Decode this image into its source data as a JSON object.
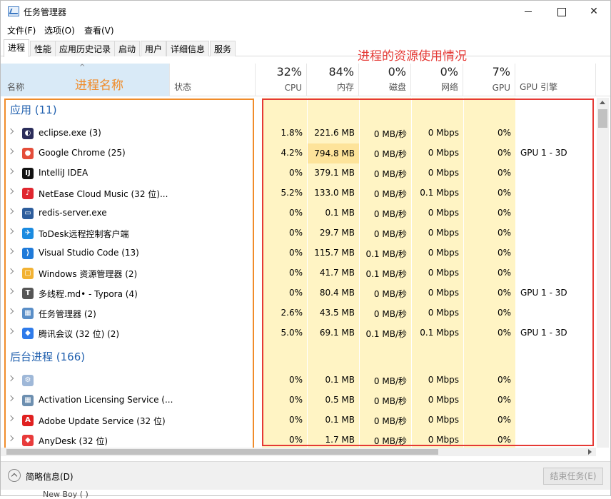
{
  "window": {
    "title": "任务管理器"
  },
  "menu": [
    "文件(F)",
    "选项(O)",
    "查看(V)"
  ],
  "tabs": [
    "进程",
    "性能",
    "应用历史记录",
    "启动",
    "用户",
    "详细信息",
    "服务"
  ],
  "header": {
    "name": "名称",
    "status": "状态",
    "cpu_pct": "32%",
    "cpu": "CPU",
    "mem_pct": "84%",
    "mem": "内存",
    "disk_pct": "0%",
    "disk": "磁盘",
    "net_pct": "0%",
    "net": "网络",
    "gpu_pct": "7%",
    "gpu": "GPU",
    "gpu_engine": "GPU 引擎"
  },
  "annotations": {
    "name_label": "进程名称",
    "resource_label": "进程的资源使用情况"
  },
  "groups": {
    "apps": "应用 (11)",
    "background": "后台进程 (166)"
  },
  "apps": [
    {
      "name": "eclipse.exe (3)",
      "cpu": "1.8%",
      "mem": "221.6 MB",
      "disk": "0 MB/秒",
      "net": "0 Mbps",
      "gpu": "0%",
      "gpu_engine": ""
    },
    {
      "name": "Google Chrome (25)",
      "cpu": "4.2%",
      "mem": "794.8 MB",
      "disk": "0 MB/秒",
      "net": "0 Mbps",
      "gpu": "0%",
      "gpu_engine": "GPU 1 - 3D"
    },
    {
      "name": "IntelliJ IDEA",
      "cpu": "0%",
      "mem": "379.1 MB",
      "disk": "0 MB/秒",
      "net": "0 Mbps",
      "gpu": "0%",
      "gpu_engine": ""
    },
    {
      "name": "NetEase Cloud Music (32 位)...",
      "cpu": "5.2%",
      "mem": "133.0 MB",
      "disk": "0 MB/秒",
      "net": "0.1 Mbps",
      "gpu": "0%",
      "gpu_engine": ""
    },
    {
      "name": "redis-server.exe",
      "cpu": "0%",
      "mem": "0.1 MB",
      "disk": "0 MB/秒",
      "net": "0 Mbps",
      "gpu": "0%",
      "gpu_engine": ""
    },
    {
      "name": "ToDesk远程控制客户端",
      "cpu": "0%",
      "mem": "29.7 MB",
      "disk": "0 MB/秒",
      "net": "0 Mbps",
      "gpu": "0%",
      "gpu_engine": ""
    },
    {
      "name": "Visual Studio Code (13)",
      "cpu": "0%",
      "mem": "115.7 MB",
      "disk": "0.1 MB/秒",
      "net": "0 Mbps",
      "gpu": "0%",
      "gpu_engine": ""
    },
    {
      "name": "Windows 资源管理器 (2)",
      "cpu": "0%",
      "mem": "41.7 MB",
      "disk": "0.1 MB/秒",
      "net": "0 Mbps",
      "gpu": "0%",
      "gpu_engine": ""
    },
    {
      "name": "多线程.md• - Typora (4)",
      "cpu": "0%",
      "mem": "80.4 MB",
      "disk": "0 MB/秒",
      "net": "0 Mbps",
      "gpu": "0%",
      "gpu_engine": "GPU 1 - 3D"
    },
    {
      "name": "任务管理器 (2)",
      "cpu": "2.6%",
      "mem": "43.5 MB",
      "disk": "0 MB/秒",
      "net": "0 Mbps",
      "gpu": "0%",
      "gpu_engine": ""
    },
    {
      "name": "腾讯会议 (32 位) (2)",
      "cpu": "5.0%",
      "mem": "69.1 MB",
      "disk": "0.1 MB/秒",
      "net": "0.1 Mbps",
      "gpu": "0%",
      "gpu_engine": "GPU 1 - 3D"
    }
  ],
  "background": [
    {
      "name": "",
      "cpu": "0%",
      "mem": "0.1 MB",
      "disk": "0 MB/秒",
      "net": "0 Mbps",
      "gpu": "0%"
    },
    {
      "name": "Activation Licensing Service (...",
      "cpu": "0%",
      "mem": "0.5 MB",
      "disk": "0 MB/秒",
      "net": "0 Mbps",
      "gpu": "0%"
    },
    {
      "name": "Adobe Update Service (32 位)",
      "cpu": "0%",
      "mem": "0.1 MB",
      "disk": "0 MB/秒",
      "net": "0 Mbps",
      "gpu": "0%"
    },
    {
      "name": "AnyDesk (32 位)",
      "cpu": "0%",
      "mem": "1.7 MB",
      "disk": "0 MB/秒",
      "net": "0 Mbps",
      "gpu": "0%"
    }
  ],
  "footer": {
    "fewer_details": "简略信息(D)",
    "end_task": "结束任务(E)"
  },
  "under_text": "New Boy ( )",
  "colors": {
    "cell_light": "#fff4c4",
    "cell_mem_high": "#fde39a",
    "annot_orange": "#f08c2a",
    "annot_red": "#e53935",
    "group_blue": "#1f5fae"
  }
}
